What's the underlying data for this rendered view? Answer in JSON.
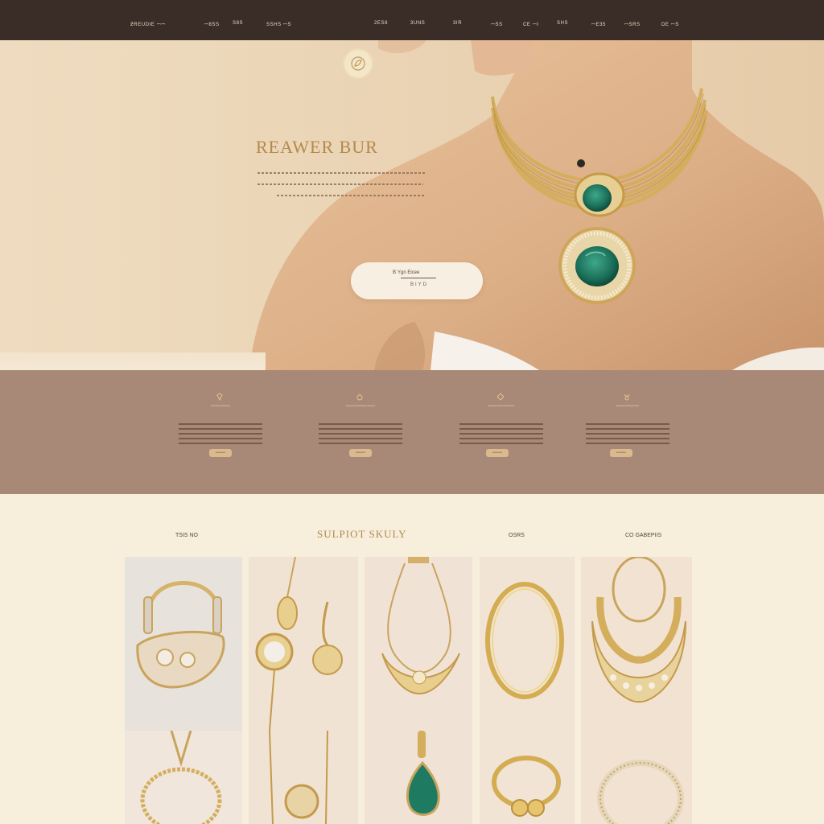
{
  "topbar": {
    "brand": "ƵREUDIE ꟷꟷ",
    "links_left": [
      "ꟷ8SS",
      "S8S",
      "SSHS ꟷS"
    ],
    "links_right": [
      "2ES8",
      "3UNS",
      "3IR",
      "ꟷSS",
      "CE ꟷI",
      "SHS",
      "ꟷE35",
      "ꟷSRS",
      "DE ꟷS"
    ]
  },
  "hero": {
    "title": "REAWER BUR",
    "cta_top": "B˙Ygn      Eicee",
    "cta_bottom": "BIYD"
  },
  "features": [
    {
      "title": "ꟷꟷꟷꟷꟷꟷ",
      "button": "ꟷꟷꟷ"
    },
    {
      "title": "ꟷꟷꟷꟷꟷꟷꟷꟷꟷ",
      "button": "ꟷꟷꟷ"
    },
    {
      "title": "ꟷꟷꟷꟷꟷꟷꟷꟷ",
      "button": "ꟷꟷꟷ"
    },
    {
      "title": "ꟷꟷꟷꟷꟷꟷꟷ",
      "button": "ꟷꟷꟷ"
    }
  ],
  "products": {
    "title": "SULPIOT SKULY",
    "categories": [
      "TSIS NO",
      "OSRS",
      "CO GABEPIIS"
    ]
  },
  "colors": {
    "topbar": "#3a2c27",
    "features_band": "#a88876",
    "gold": "#d2ad5c",
    "emerald": "#1f7a62"
  }
}
